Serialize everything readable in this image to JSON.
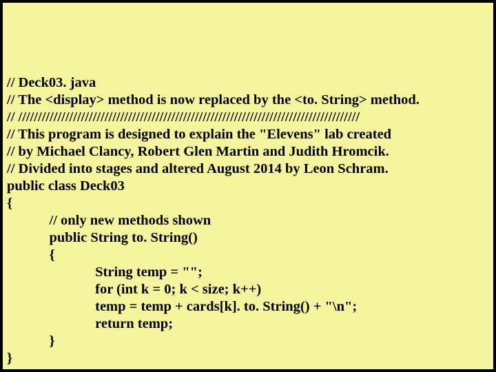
{
  "code": {
    "l1": "// Deck03. java",
    "l2": "// The <display> method is now replaced by the <to. String> method.",
    "l3": "// ///////////////////////////////////////////////////////////////////////////////////////",
    "l4": "// This program is designed to explain the \"Elevens\" lab created",
    "l5": "// by Michael Clancy, Robert Glen Martin and Judith Hromcik.",
    "l6": "// Divided into stages and altered August 2014 by Leon Schram.",
    "l7": "",
    "l8": "public class Deck03",
    "l9": "{",
    "l10": "            // only new methods shown",
    "l11": "",
    "l12": "            public String to. String()",
    "l13": "            {",
    "l14": "                         String temp = \"\";",
    "l15": "                         for (int k = 0; k < size; k++)",
    "l16": "                         temp = temp + cards[k]. to. String() + \"\\n\";",
    "l17": "                         return temp;",
    "l18": "            }",
    "l19": "}"
  }
}
